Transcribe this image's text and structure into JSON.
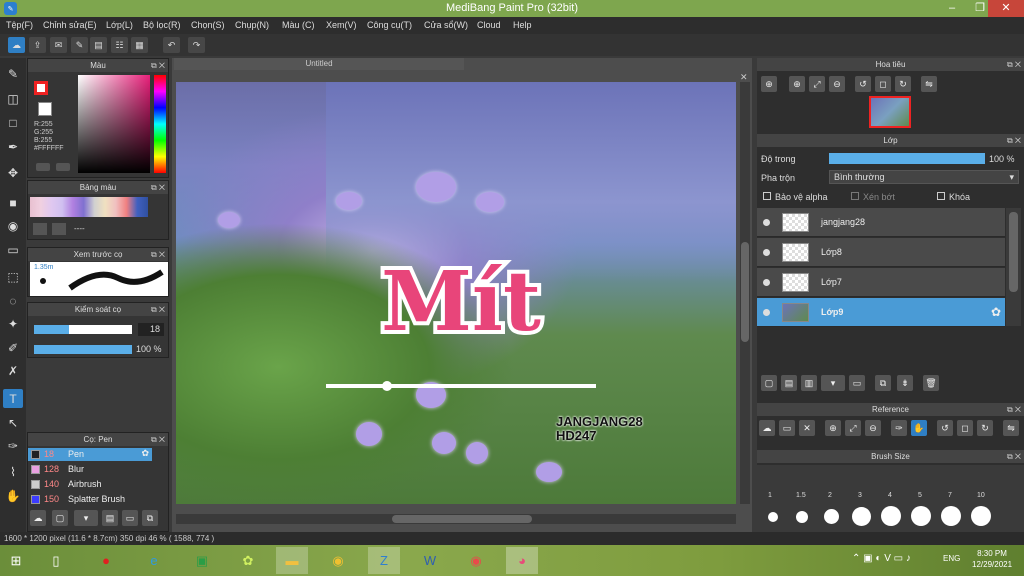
{
  "title": "MediBang Paint Pro (32bit)",
  "menu": [
    "Tệp(F)",
    "Chỉnh sửa(E)",
    "Lớp(L)",
    "Bộ lọc(R)",
    "Chọn(S)",
    "Chụp(N)",
    "Màu (C)",
    "Xem(V)",
    "Công cụ(T)",
    "Cửa sổ(W)",
    "Cloud",
    "Help"
  ],
  "tab": "Untitled",
  "color": {
    "title": "Màu",
    "r": "R:255",
    "g": "G:255",
    "b": "B:255",
    "hex": "#FFFFFF"
  },
  "palette": {
    "title": "Bảng màu",
    "label": "----"
  },
  "brushPreview": {
    "title": "Xem trước cọ",
    "size": "1.35m"
  },
  "brushControl": {
    "title": "Kiểm soát cọ",
    "size": "18",
    "opacity": "100 %",
    "opacity_value": 100
  },
  "brushes": {
    "title": "Cọ: Pen",
    "items": [
      {
        "num": "18",
        "name": "Pen",
        "color": "#222"
      },
      {
        "num": "128",
        "name": "Blur",
        "color": "#e8a0e0"
      },
      {
        "num": "140",
        "name": "Airbrush",
        "color": "#ccc"
      },
      {
        "num": "150",
        "name": "Splatter Brush",
        "color": "#3c3cff"
      }
    ]
  },
  "artwork": {
    "title": "Mít",
    "tag1": "JANGJANG28",
    "tag2": "HD247"
  },
  "navigator": {
    "title": "Hoa tiêu"
  },
  "layers": {
    "title": "Lớp",
    "opacity_label": "Độ trong",
    "opacity": "100 %",
    "opacity_value": 100,
    "blend_label": "Pha trộn",
    "blend": "Bình thường",
    "protect_alpha": "Bảo vệ alpha",
    "clipping": "Xén bớt",
    "lock": "Khóa",
    "items": [
      {
        "name": "jangjang28",
        "selected": false
      },
      {
        "name": "Lớp8",
        "selected": false
      },
      {
        "name": "Lớp7",
        "selected": false
      },
      {
        "name": "Lớp9",
        "selected": true
      }
    ]
  },
  "reference": {
    "title": "Reference"
  },
  "brushSize": {
    "title": "Brush Size",
    "sizes": [
      "1",
      "1.5",
      "2",
      "3",
      "4",
      "5",
      "7",
      "10"
    ]
  },
  "status": {
    "info": "1600 * 1200 pixel  (11.6 * 8.7cm)  350 dpi  46 %  ( 1588, 774 )"
  },
  "taskbar": {
    "lang": "ENG",
    "time": "8:30 PM",
    "date": "12/29/2021"
  }
}
